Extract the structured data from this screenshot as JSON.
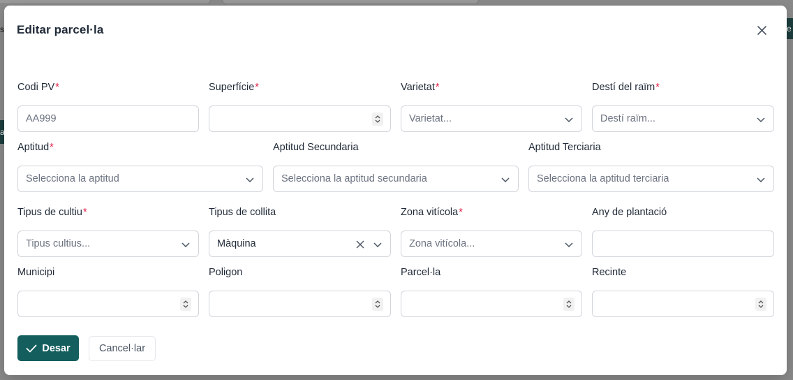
{
  "modal": {
    "title": "Editar parcel·la",
    "close_icon": "close-icon"
  },
  "background": {
    "fragment_left_1": "s",
    "fragment_left_2": "a",
    "fragment_right": "e"
  },
  "fields": {
    "codi_pv": {
      "label": "Codi PV",
      "required": "*",
      "placeholder": "AA999"
    },
    "superficie": {
      "label": "Superfície",
      "required": "*",
      "value": ""
    },
    "varietat": {
      "label": "Varietat",
      "required": "*",
      "placeholder": "Varietat..."
    },
    "desti_raim": {
      "label": "Destí del raïm",
      "required": "*",
      "placeholder": "Destí raïm..."
    },
    "aptitud": {
      "label": "Aptitud",
      "required": "*",
      "placeholder": "Selecciona la aptitud"
    },
    "aptitud_secundaria": {
      "label": "Aptitud Secundaria",
      "placeholder": "Selecciona la aptitud secundaria"
    },
    "aptitud_terciaria": {
      "label": "Aptitud Terciaria",
      "placeholder": "Selecciona la aptitud terciaria"
    },
    "tipus_cultiu": {
      "label": "Tipus de cultiu",
      "required": "*",
      "placeholder": "Tipus cultius..."
    },
    "tipus_collita": {
      "label": "Tipus de collita",
      "value": "Màquina"
    },
    "zona_viticola": {
      "label": "Zona vitícola",
      "required": "*",
      "placeholder": "Zona vitícola..."
    },
    "any_plantacio": {
      "label": "Any de plantació",
      "value": ""
    },
    "municipi": {
      "label": "Municipi",
      "value": ""
    },
    "poligon": {
      "label": "Poligon",
      "value": ""
    },
    "parcela": {
      "label": "Parcel·la",
      "value": ""
    },
    "recinte": {
      "label": "Recinte",
      "value": ""
    }
  },
  "actions": {
    "save_label": "Desar",
    "cancel_label": "Cancel·lar"
  },
  "colors": {
    "primary": "#155e5e",
    "required": "#e11d48",
    "border": "#d1d5db",
    "overlay": "#8a8a8a"
  }
}
